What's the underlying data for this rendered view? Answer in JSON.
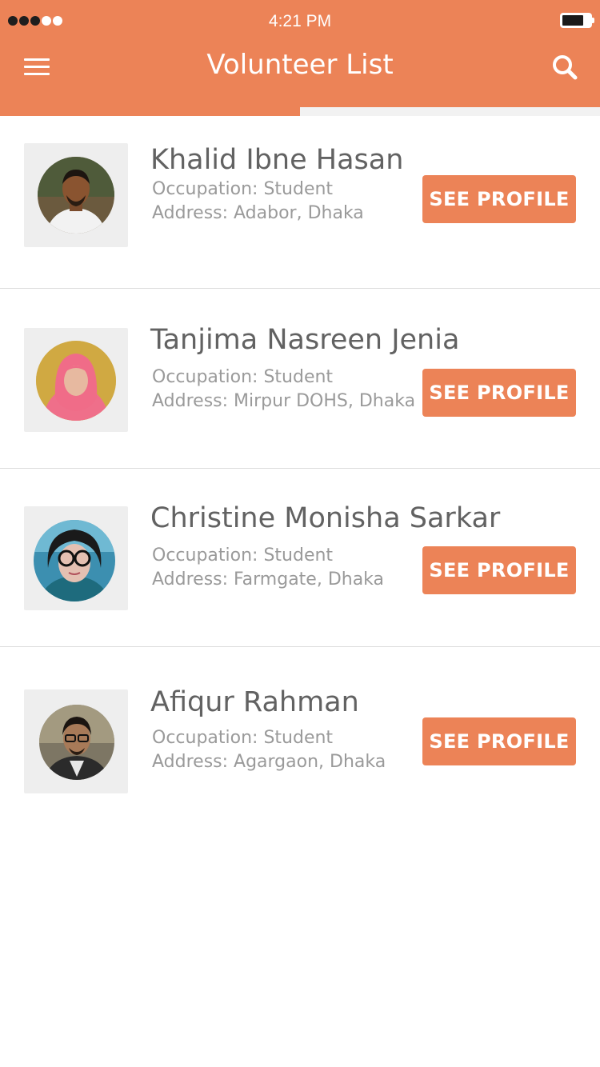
{
  "status_bar": {
    "time": "4:21 PM",
    "signal_icon": "signal-dots-icon",
    "battery_icon": "battery-icon"
  },
  "header": {
    "title": "Volunteer List",
    "menu_icon": "hamburger-menu-icon",
    "search_icon": "search-icon"
  },
  "colors": {
    "accent": "#ec8357",
    "name_text": "#626262",
    "detail_text": "#9a9a9a",
    "avatar_box": "#eeeeee"
  },
  "volunteers": [
    {
      "name": "Khalid Ibne Hasan",
      "occupation": "Occupation: Student",
      "address": "Address: Adabor, Dhaka",
      "button_label": "SEE PROFILE"
    },
    {
      "name": "Tanjima Nasreen Jenia",
      "occupation": "Occupation: Student",
      "address": "Address: Mirpur DOHS, Dhaka",
      "button_label": "SEE PROFILE"
    },
    {
      "name": "Christine Monisha Sarkar",
      "occupation": "Occupation: Student",
      "address": "Address: Farmgate, Dhaka",
      "button_label": "SEE PROFILE"
    },
    {
      "name": "Afiqur Rahman",
      "occupation": "Occupation: Student",
      "address": "Address: Agargaon, Dhaka",
      "button_label": "SEE PROFILE"
    }
  ]
}
